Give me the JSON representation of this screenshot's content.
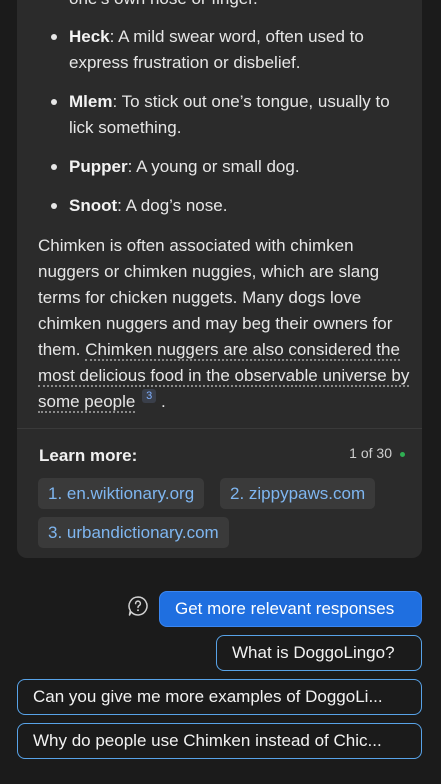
{
  "colors": {
    "background": "#1b1b1b",
    "card": "#2b2b2b",
    "link": "#7fb6f0",
    "accent_button": "#1f6fe0",
    "pill_border": "#58a3e8",
    "status_dot": "#2fae52"
  },
  "response": {
    "partial_top_line": "one’s own nose or finger.",
    "definitions": [
      {
        "term": "Heck",
        "definition": ": A mild swear word, often used to express frustration or disbelief."
      },
      {
        "term": "Mlem",
        "definition": ": To stick out one’s tongue, usually to lick something."
      },
      {
        "term": "Pupper",
        "definition": ": A young or small dog."
      },
      {
        "term": "Snoot",
        "definition": ": A dog’s nose."
      }
    ],
    "paragraph_plain": "Chimken is often associated with chimken nuggers or chimken nuggies, which are slang terms for chicken nuggets. Many dogs love chimken nuggers and may beg their owners for them. ",
    "paragraph_cited": "Chimken nuggers are also considered the most delicious food in the observable universe by some people",
    "citation_number": "3",
    "paragraph_end": ".",
    "learn_more_label": "Learn more:",
    "counter": "1 of 30",
    "sources": [
      "1. en.wiktionary.org",
      "2. zippypaws.com",
      "3. urbandictionary.com"
    ]
  },
  "suggestions": {
    "help_icon": "question-bubble-icon",
    "primary_button": "Get more relevant responses",
    "items": [
      "What is DoggoLingo?",
      "Can you give me more examples of DoggoLi...",
      "Why do people use Chimken instead of Chic..."
    ]
  }
}
